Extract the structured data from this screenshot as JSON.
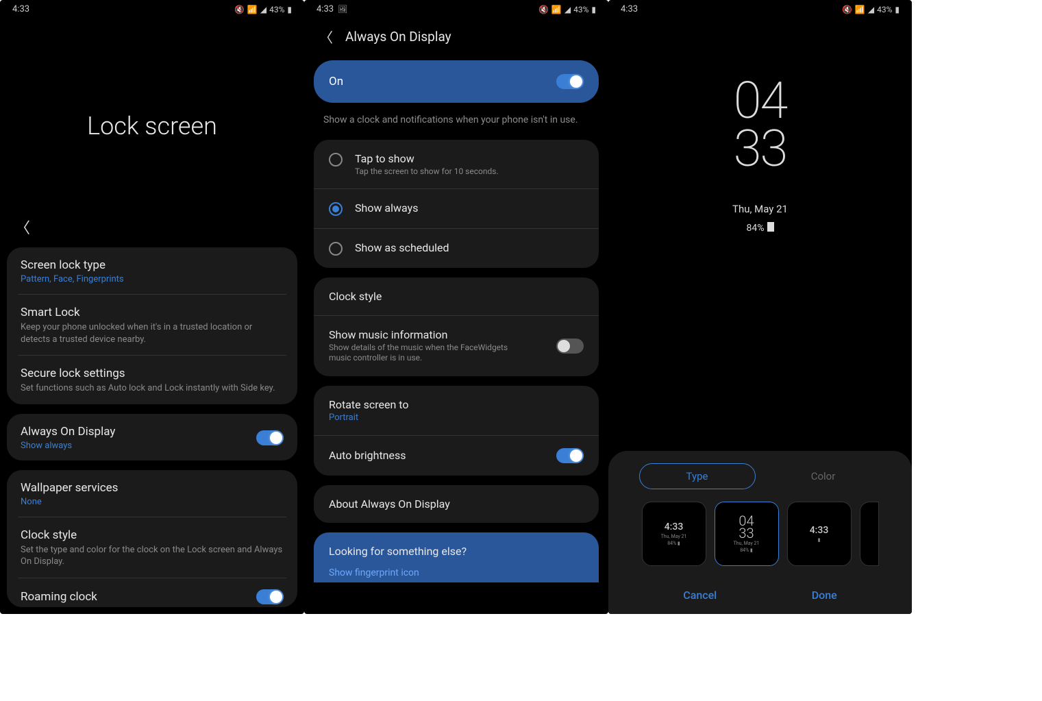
{
  "status": {
    "time": "4:33",
    "battery": "43%"
  },
  "screen1": {
    "title": "Lock screen",
    "g1": {
      "lock_type": {
        "title": "Screen lock type",
        "sub": "Pattern, Face, Fingerprints"
      },
      "smart_lock": {
        "title": "Smart Lock",
        "sub": "Keep your phone unlocked when it's in a trusted location or detects a trusted device nearby."
      },
      "secure": {
        "title": "Secure lock settings",
        "sub": "Set functions such as Auto lock and Lock instantly with Side key."
      }
    },
    "aod": {
      "title": "Always On Display",
      "sub": "Show always"
    },
    "g3": {
      "wallpaper": {
        "title": "Wallpaper services",
        "sub": "None"
      },
      "clock": {
        "title": "Clock style",
        "sub": "Set the type and color for the clock on the Lock screen and Always On Display."
      },
      "roaming": {
        "title": "Roaming clock"
      }
    }
  },
  "screen2": {
    "title": "Always On Display",
    "on_label": "On",
    "desc": "Show a clock and notifications when your phone isn't in use.",
    "opts": {
      "tap": {
        "t": "Tap to show",
        "s": "Tap the screen to show for 10 seconds."
      },
      "always": {
        "t": "Show always"
      },
      "sched": {
        "t": "Show as scheduled"
      }
    },
    "clock_style": "Clock style",
    "music": {
      "t": "Show music information",
      "s": "Show details of the music when the FaceWidgets music controller is in use."
    },
    "rotate": {
      "t": "Rotate screen to",
      "s": "Portrait"
    },
    "auto_bright": "Auto brightness",
    "about": "About Always On Display",
    "looking": {
      "t": "Looking for something else?",
      "l": "Show fingerprint icon"
    }
  },
  "screen3": {
    "clock_h": "04",
    "clock_m": "33",
    "date": "Thu, May 21",
    "batt": "84%",
    "tabs": {
      "type": "Type",
      "color": "Color"
    },
    "cards": {
      "c1_time": "4:33",
      "c1_date": "Thu, May 21",
      "c2_h": "04",
      "c2_m": "33",
      "c2_sub": "Thu, May 21",
      "c3_time": "4:33"
    },
    "cancel": "Cancel",
    "done": "Done"
  }
}
